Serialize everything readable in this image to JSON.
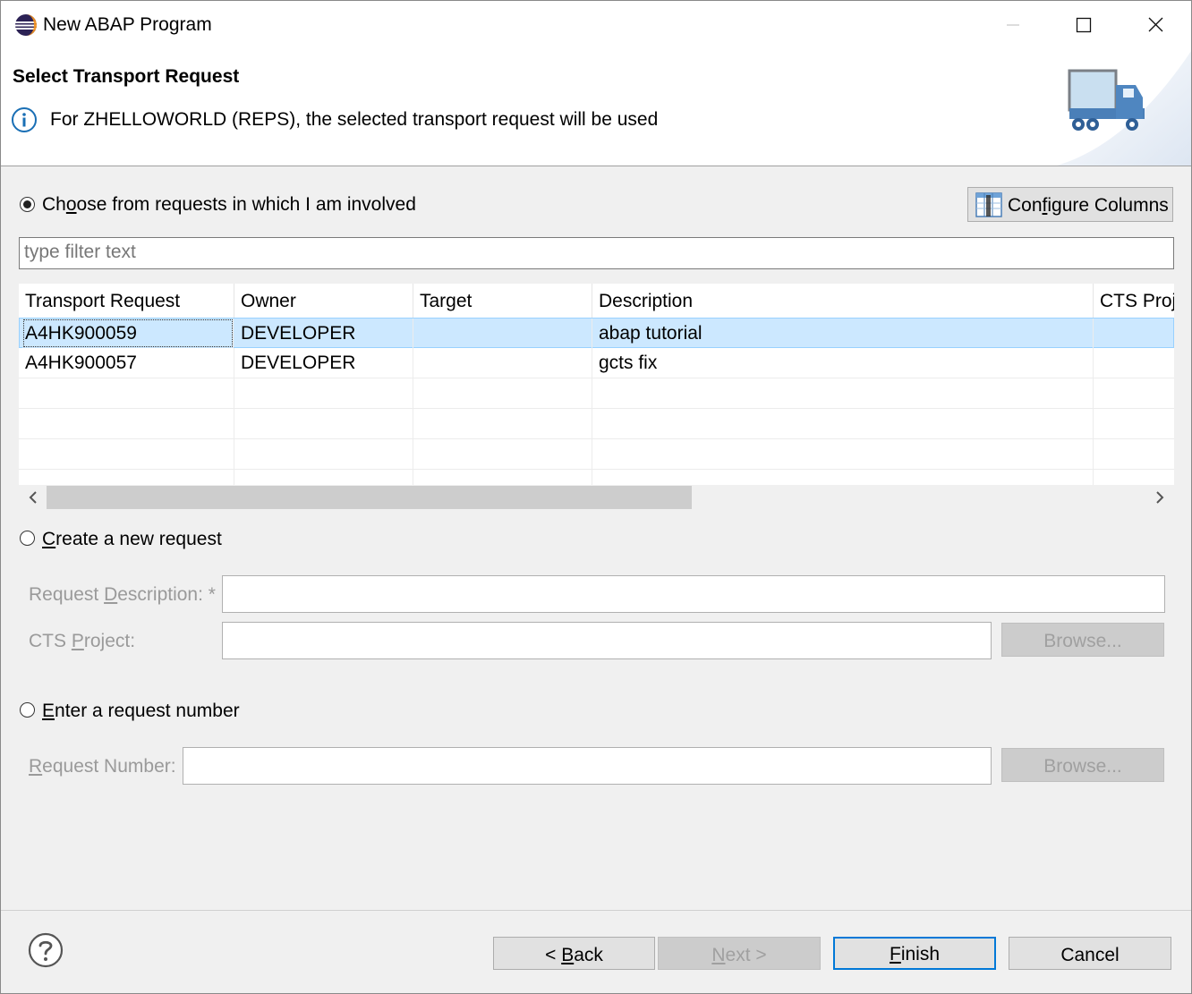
{
  "window": {
    "title": "New ABAP Program",
    "controls": [
      "minimize-icon",
      "maximize-icon",
      "close-icon"
    ]
  },
  "banner": {
    "title": "Select Transport Request",
    "message": "For ZHELLOWORLD (REPS), the selected transport request will be used",
    "icon": "info-icon",
    "image": "truck-icon"
  },
  "choose": {
    "label_pre": "Ch",
    "label_mn": "o",
    "label_post": "ose from requests in which I am involved",
    "selected": true
  },
  "configure_columns": {
    "label_pre": "Con",
    "label_mn": "f",
    "label_post": "igure Columns",
    "icon": "columns-icon"
  },
  "filter": {
    "placeholder": "type filter text",
    "value": ""
  },
  "table": {
    "columns": [
      "Transport Request",
      "Owner",
      "Target",
      "Description",
      "CTS Proje"
    ],
    "rows": [
      {
        "request": "A4HK900059",
        "owner": "DEVELOPER",
        "target": "",
        "description": "abap tutorial",
        "cts": "",
        "selected": true
      },
      {
        "request": "A4HK900057",
        "owner": "DEVELOPER",
        "target": "",
        "description": "gcts fix",
        "cts": "",
        "selected": false
      }
    ]
  },
  "create": {
    "label_mn": "C",
    "label_post": "reate a new request",
    "selected": false,
    "desc_label_pre": "Request ",
    "desc_label_mn": "D",
    "desc_label_post": "escription: *",
    "desc_value": "",
    "cts_label_pre": "CTS ",
    "cts_label_mn": "P",
    "cts_label_post": "roject:",
    "cts_value": "",
    "browse_label": "Browse..."
  },
  "enter": {
    "label_mn": "E",
    "label_post": "nter a request number",
    "selected": false,
    "num_label_mn": "R",
    "num_label_post": "equest Number:",
    "num_value": "",
    "browse_label": "Browse..."
  },
  "footer": {
    "help_icon": "help-icon",
    "back_pre": "< ",
    "back_mn": "B",
    "back_post": "ack",
    "next_mn": "N",
    "next_post": "ext >",
    "finish_mn": "F",
    "finish_post": "inish",
    "cancel": "Cancel"
  }
}
